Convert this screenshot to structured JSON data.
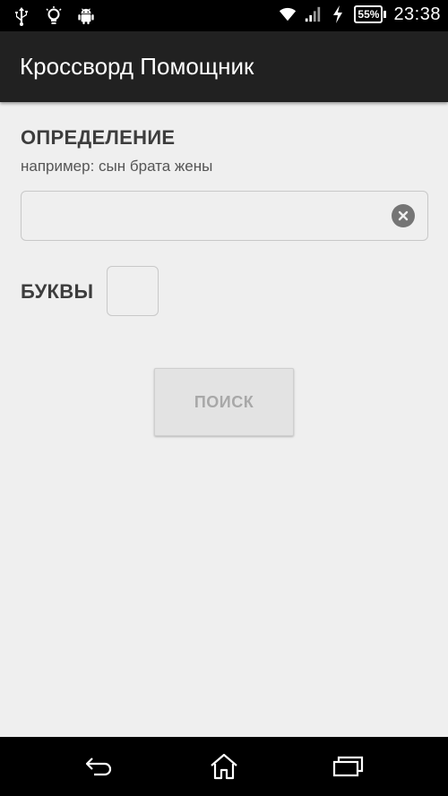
{
  "status_bar": {
    "left_icons": [
      "usb-icon",
      "lightbulb-icon",
      "android-icon"
    ],
    "right_icons": [
      "wifi-icon",
      "signal-icon",
      "charging-icon"
    ],
    "battery_percent": "55%",
    "time": "23:38"
  },
  "app": {
    "title": "Кроссворд Помощник"
  },
  "definition": {
    "heading": "ОПРЕДЕЛЕНИЕ",
    "hint": "например: сын брата жены",
    "value": "",
    "clear_icon": "clear-icon"
  },
  "letters": {
    "label": "БУКВЫ",
    "value": ""
  },
  "search": {
    "label": "ПОИСК",
    "enabled": false
  },
  "nav_bar": {
    "icons": [
      "back-icon",
      "home-icon",
      "recent-apps-icon"
    ]
  }
}
